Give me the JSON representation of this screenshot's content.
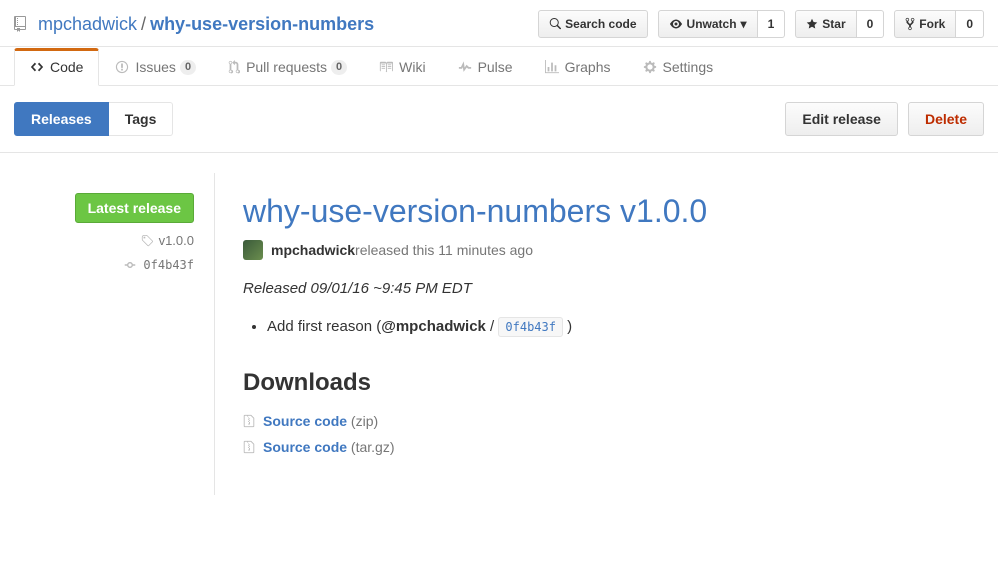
{
  "repo": {
    "owner": "mpchadwick",
    "name": "why-use-version-numbers"
  },
  "header_buttons": {
    "search": "Search code",
    "unwatch": "Unwatch",
    "watch_count": "1",
    "star": "Star",
    "star_count": "0",
    "fork": "Fork",
    "fork_count": "0"
  },
  "tabs": {
    "code": "Code",
    "issues": "Issues",
    "issues_count": "0",
    "pulls": "Pull requests",
    "pulls_count": "0",
    "wiki": "Wiki",
    "pulse": "Pulse",
    "graphs": "Graphs",
    "settings": "Settings"
  },
  "subnav": {
    "releases": "Releases",
    "tags": "Tags",
    "edit": "Edit release",
    "delete": "Delete"
  },
  "release": {
    "latest_label": "Latest release",
    "tag": "v1.0.0",
    "commit": "0f4b43f",
    "title": "why-use-version-numbers v1.0.0",
    "author": "mpchadwick",
    "released_text": " released this 11 minutes ago",
    "subtitle": "Released 09/01/16 ~9:45 PM EDT",
    "item_prefix": "Add first reason (",
    "item_handle": "@mpchadwick",
    "item_sep": " / ",
    "item_commit": "0f4b43f",
    "item_suffix": " )",
    "downloads_title": "Downloads",
    "dl1_name": "Source code",
    "dl1_ext": " (zip)",
    "dl2_name": "Source code",
    "dl2_ext": " (tar.gz)"
  }
}
